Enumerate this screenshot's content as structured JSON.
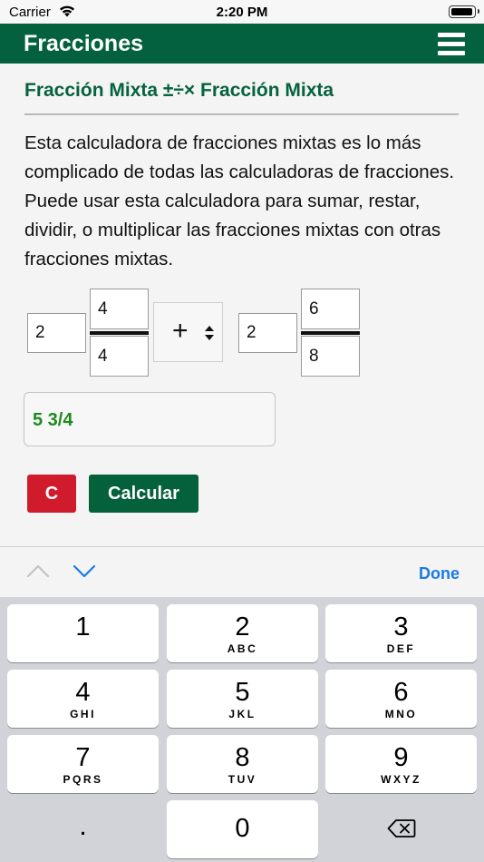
{
  "status": {
    "carrier": "Carrier",
    "time": "2:20 PM"
  },
  "app": {
    "title": "Fracciones"
  },
  "page": {
    "heading": "Fracción Mixta ±÷× Fracción Mixta",
    "description": "Esta calculadora de fracciones mixtas es lo más complicado de todas las calculadoras de fracciones. Puede usar esta calculadora para sumar, restar, dividir, o multiplicar las fracciones mixtas con otras fracciones mixtas."
  },
  "calc": {
    "first": {
      "whole": "2",
      "numerator": "4",
      "denominator": "4"
    },
    "operator": "+",
    "second": {
      "whole": "2",
      "numerator": "6",
      "denominator": "8"
    },
    "result": "5 3/4",
    "clear_label": "C",
    "calculate_label": "Calcular"
  },
  "keyboard": {
    "done_label": "Done",
    "keys": [
      {
        "num": "1",
        "sub": ""
      },
      {
        "num": "2",
        "sub": "ABC"
      },
      {
        "num": "3",
        "sub": "DEF"
      },
      {
        "num": "4",
        "sub": "GHI"
      },
      {
        "num": "5",
        "sub": "JKL"
      },
      {
        "num": "6",
        "sub": "MNO"
      },
      {
        "num": "7",
        "sub": "PQRS"
      },
      {
        "num": "8",
        "sub": "TUV"
      },
      {
        "num": "9",
        "sub": "WXYZ"
      }
    ],
    "dot": ".",
    "zero": "0"
  },
  "colors": {
    "brand": "#04613f",
    "clear": "#cf1b2c",
    "result_text": "#1d8a1d",
    "link": "#1a7ae6"
  }
}
